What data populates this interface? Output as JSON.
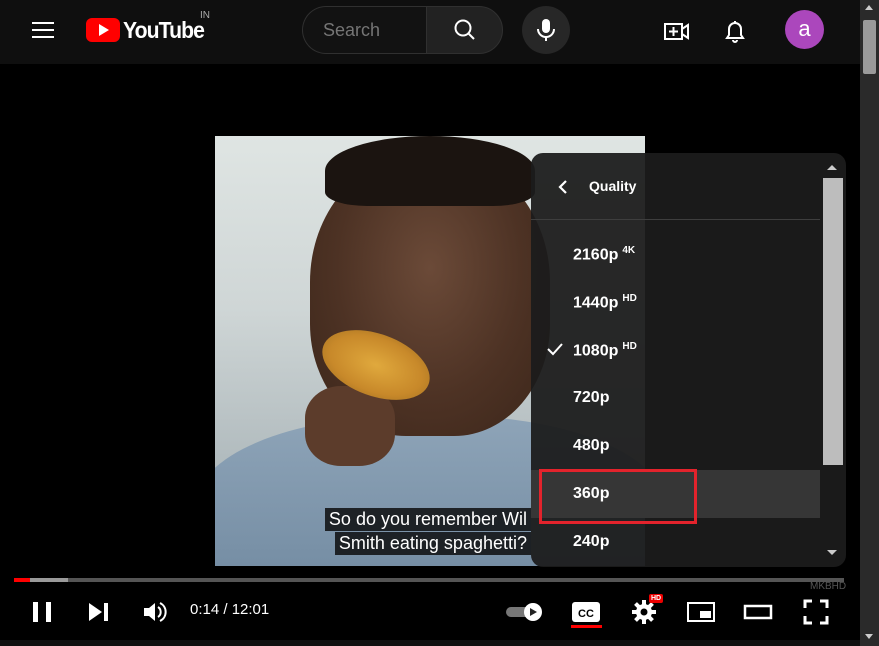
{
  "header": {
    "logo_text": "YouTube",
    "country": "IN",
    "search_placeholder": "Search",
    "avatar_letter": "a"
  },
  "video": {
    "captions": [
      "So do you remember Wil",
      "Smith eating spaghetti?"
    ],
    "watermark": "MKBHD"
  },
  "quality_menu": {
    "title": "Quality",
    "items": [
      {
        "label": "2160p",
        "badge": "4K",
        "selected": false
      },
      {
        "label": "1440p",
        "badge": "HD",
        "selected": false
      },
      {
        "label": "1080p",
        "badge": "HD",
        "selected": true
      },
      {
        "label": "720p",
        "badge": "",
        "selected": false
      },
      {
        "label": "480p",
        "badge": "",
        "selected": false
      },
      {
        "label": "360p",
        "badge": "",
        "selected": false,
        "hovered": true
      },
      {
        "label": "240p",
        "badge": "",
        "selected": false
      }
    ]
  },
  "controls": {
    "time": "0:14 / 12:01",
    "played_fraction": 0.019,
    "buffered_fraction": 0.065,
    "settings_badge": "HD"
  },
  "colors": {
    "accent": "#ff0000",
    "highlight_box": "#e3232c",
    "avatar": "#ab47bc"
  }
}
